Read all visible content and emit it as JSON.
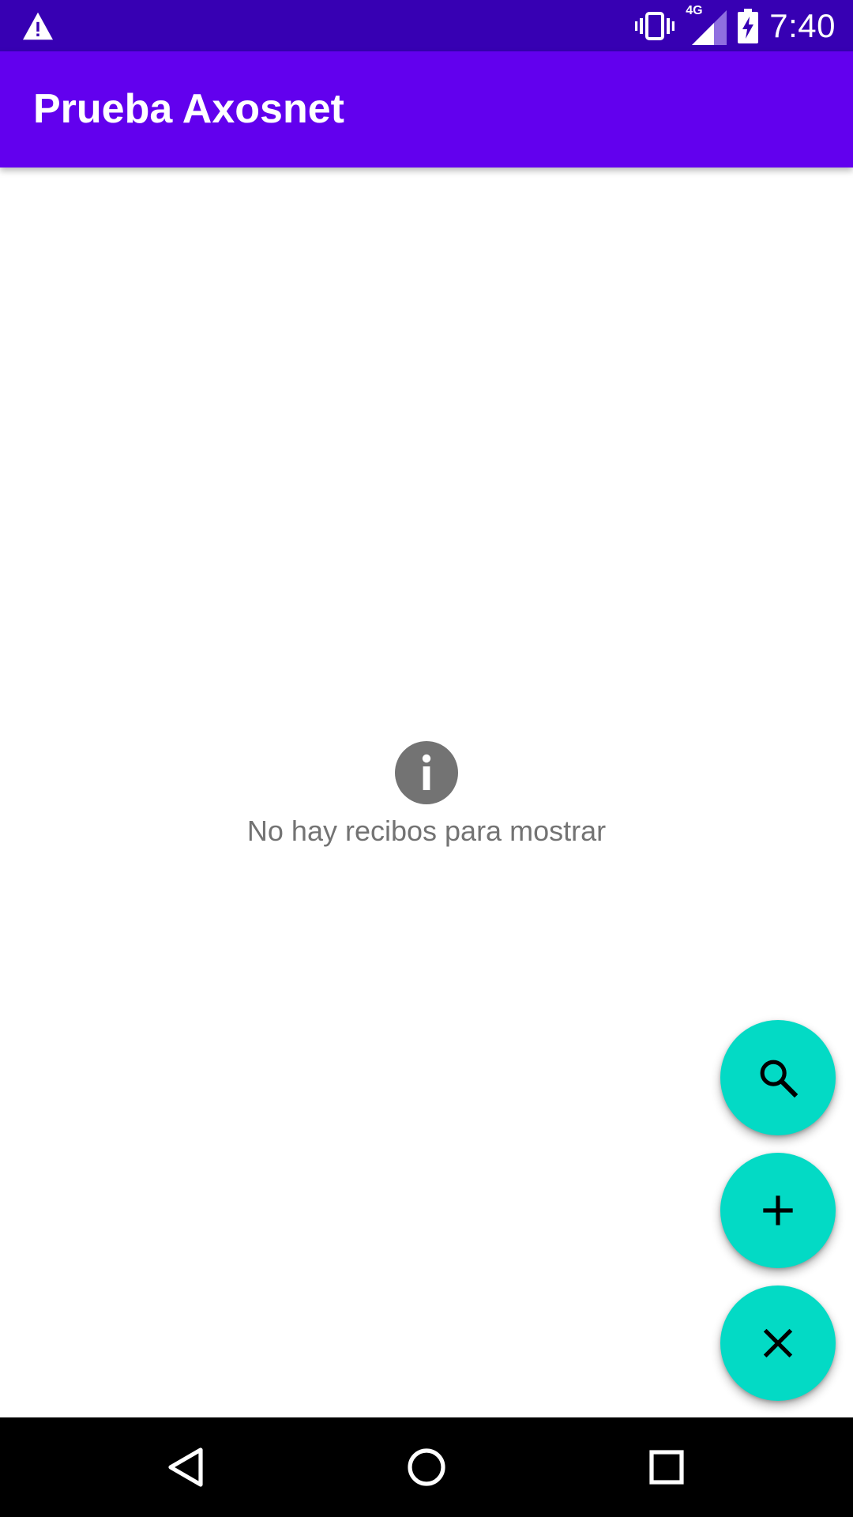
{
  "status_bar": {
    "time": "7:40",
    "network": "4G",
    "icons": [
      "warning-icon",
      "vibrate-icon",
      "signal-4g-icon",
      "battery-charging-icon"
    ]
  },
  "app_bar": {
    "title": "Prueba Axosnet"
  },
  "empty_state": {
    "icon": "info-icon",
    "message": "No hay recibos para mostrar"
  },
  "fabs": [
    {
      "icon": "search-icon"
    },
    {
      "icon": "add-icon"
    },
    {
      "icon": "close-icon"
    }
  ],
  "nav_bar": {
    "icons": [
      "back-icon",
      "home-icon",
      "recents-icon"
    ]
  },
  "colors": {
    "status_bar": "#3700b3",
    "primary": "#6200ee",
    "accent": "#03dac5",
    "empty_text": "#737373"
  }
}
